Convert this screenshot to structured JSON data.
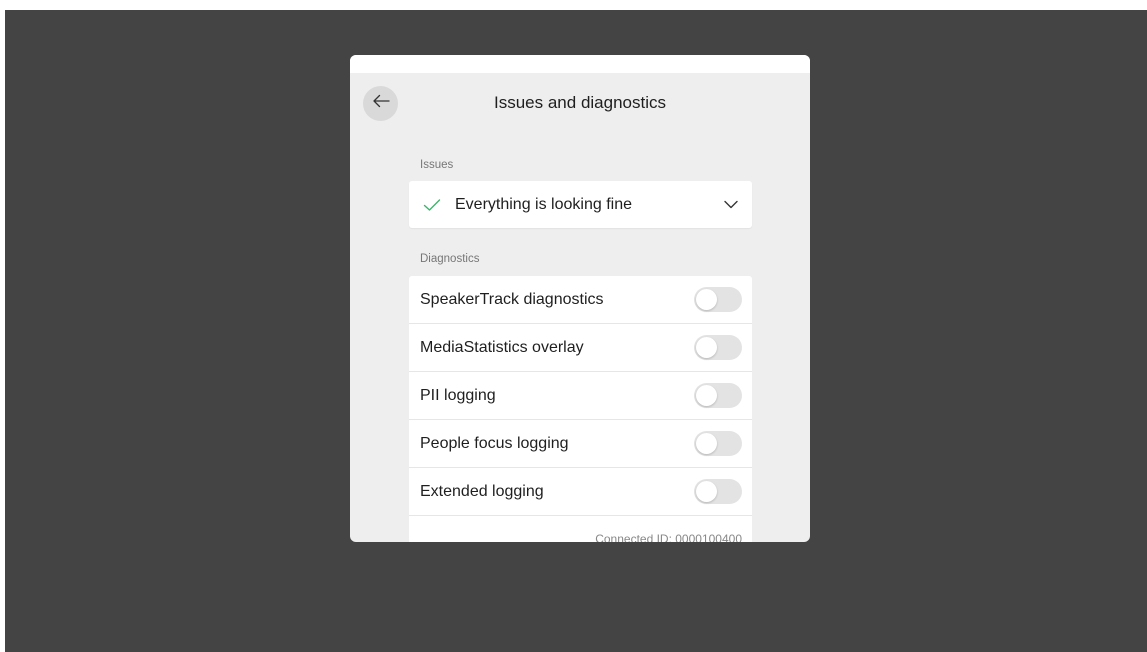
{
  "header": {
    "title": "Issues and diagnostics"
  },
  "issues": {
    "label": "Issues",
    "status": "Everything is looking fine"
  },
  "diagnostics": {
    "label": "Diagnostics",
    "items": [
      {
        "label": "SpeakerTrack diagnostics",
        "enabled": false
      },
      {
        "label": "MediaStatistics overlay",
        "enabled": false
      },
      {
        "label": "PII logging",
        "enabled": false
      },
      {
        "label": "People focus logging",
        "enabled": false
      },
      {
        "label": "Extended logging",
        "enabled": false
      }
    ],
    "partial_text": "Connected ID: 0000100400"
  },
  "colors": {
    "backdrop": "#444444",
    "panel": "#eeeeee",
    "check": "#3cb46b",
    "toggle_off": "#e3e3e3"
  },
  "icons": {
    "back": "arrow-left-icon",
    "status": "checkmark-icon",
    "expand": "chevron-down-icon"
  }
}
